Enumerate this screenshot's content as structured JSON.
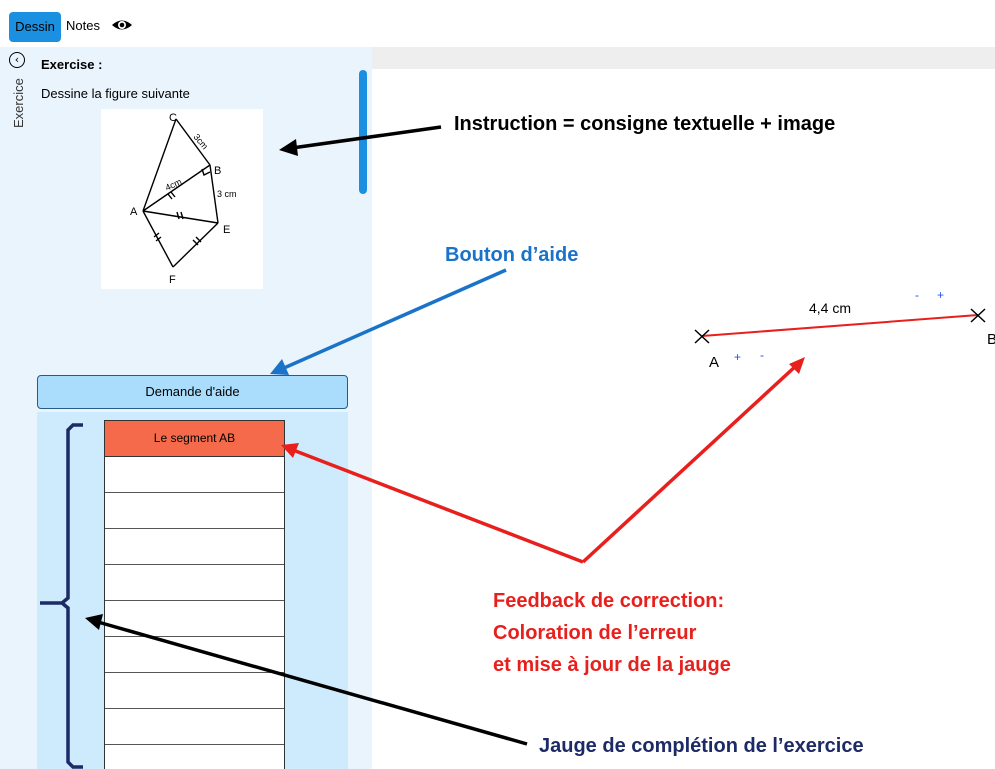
{
  "tabs": {
    "dessin": "Dessin",
    "notes": "Notes"
  },
  "sidebar": {
    "vertical_label": "Exercice"
  },
  "exercise": {
    "title": "Exercise :",
    "instruction": "Dessine la figure suivante",
    "figure_labels": {
      "C": "C",
      "B": "B",
      "A": "A",
      "E": "E",
      "F": "F",
      "cb": "3cm",
      "be": "3 cm",
      "ab": "4cm"
    }
  },
  "help_button": {
    "label": "Demande d'aide"
  },
  "gauge": {
    "first_item": "Le segment AB",
    "error_color": "#f56a4a"
  },
  "canvas": {
    "point_a": "A",
    "point_b": "B",
    "segment_length": "4,4 cm",
    "plus": "+",
    "minus": "-"
  },
  "annotations": {
    "instruction": "Instruction = consigne textuelle + image",
    "help": "Bouton d’aide",
    "feedback_1": "Feedback de correction:",
    "feedback_2": "Coloration de l’erreur",
    "feedback_3": "et mise à jour de la jauge",
    "gauge": "Jauge de complétion de l’exercice"
  },
  "colors": {
    "accent": "#1b8fe0",
    "panel": "#eaf4fd",
    "gauge_bg": "#cdebfd",
    "error": "#e8201d",
    "help_blue": "#1a73c9",
    "navy": "#1d2a66"
  }
}
